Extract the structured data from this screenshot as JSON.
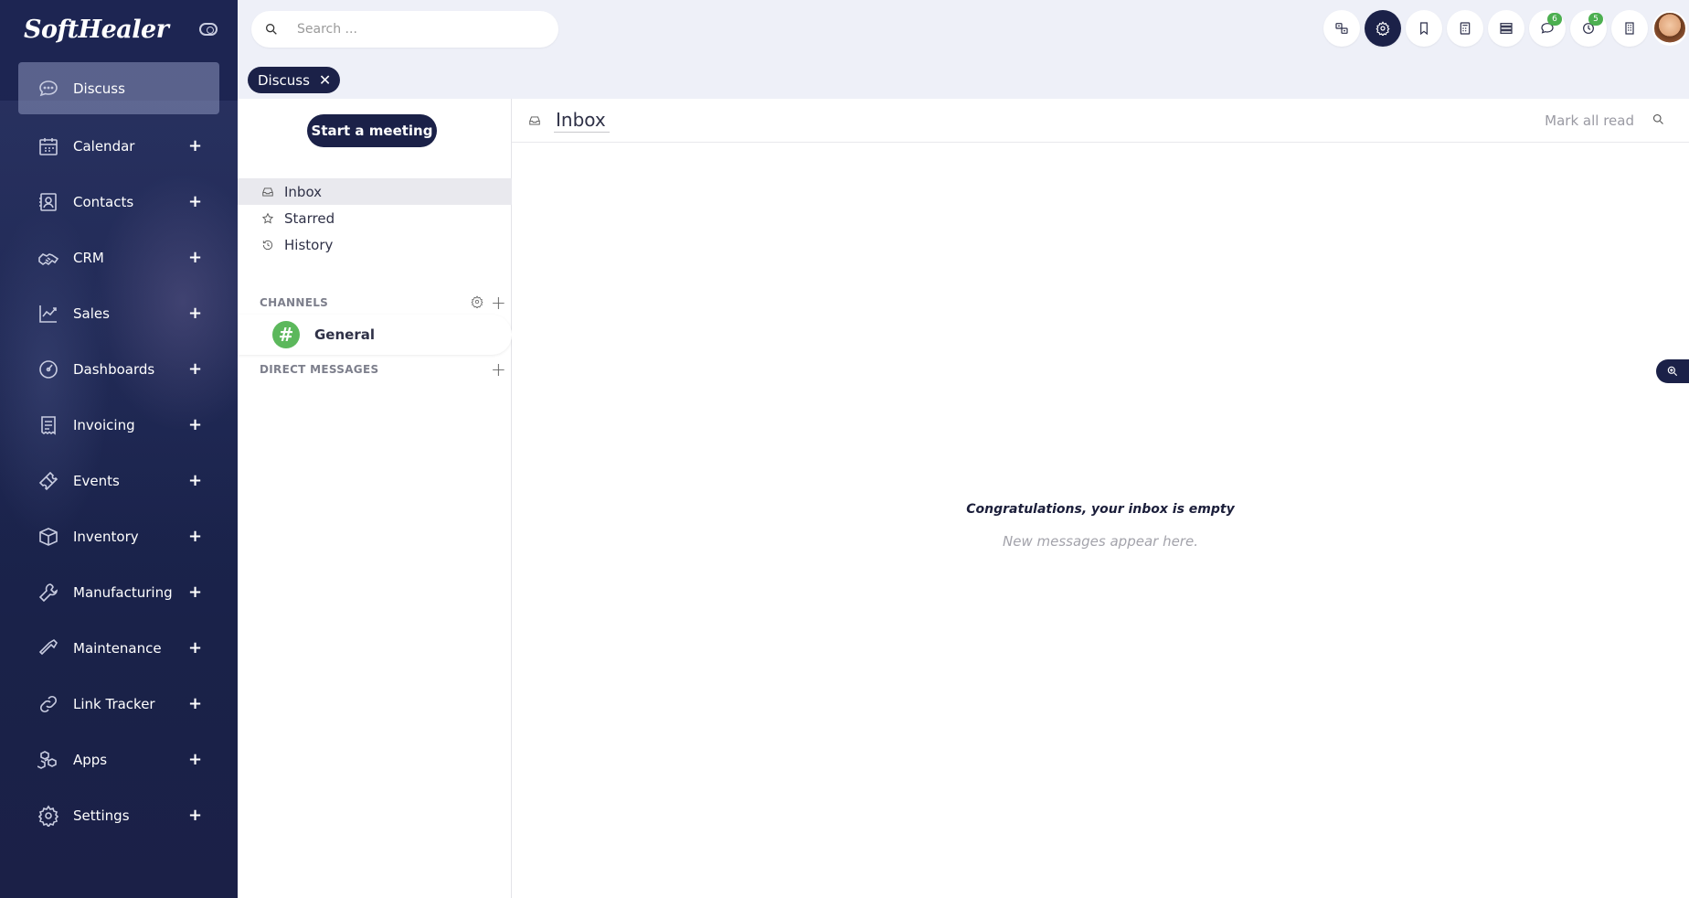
{
  "app": {
    "logo": "SoftHealer"
  },
  "sidebar": {
    "items": [
      {
        "label": "Discuss",
        "icon": "chat-icon",
        "active": true
      },
      {
        "label": "Calendar",
        "icon": "calendar-icon"
      },
      {
        "label": "Contacts",
        "icon": "contacts-icon"
      },
      {
        "label": "CRM",
        "icon": "handshake-icon"
      },
      {
        "label": "Sales",
        "icon": "chart-line-icon"
      },
      {
        "label": "Dashboards",
        "icon": "gauge-icon"
      },
      {
        "label": "Invoicing",
        "icon": "receipt-icon"
      },
      {
        "label": "Events",
        "icon": "ticket-icon"
      },
      {
        "label": "Inventory",
        "icon": "box-icon"
      },
      {
        "label": "Manufacturing",
        "icon": "wrench-icon"
      },
      {
        "label": "Maintenance",
        "icon": "hammer-icon"
      },
      {
        "label": "Link Tracker",
        "icon": "link-icon"
      },
      {
        "label": "Apps",
        "icon": "cubes-icon"
      },
      {
        "label": "Settings",
        "icon": "gear-icon"
      }
    ],
    "plus_glyph": "+"
  },
  "search": {
    "placeholder": "Search ..."
  },
  "topbar": {
    "chat_badge": "6",
    "activity_badge": "5"
  },
  "breadcrumb": {
    "label": "Discuss",
    "close": "✕"
  },
  "discuss": {
    "start_meeting": "Start a meeting",
    "mailboxes": [
      {
        "label": "Inbox",
        "active": true
      },
      {
        "label": "Starred"
      },
      {
        "label": "History"
      }
    ],
    "channels_header": "CHANNELS",
    "channels": [
      {
        "label": "General",
        "avatar": "#"
      }
    ],
    "direct_header": "DIRECT MESSAGES"
  },
  "inbox": {
    "title": "Inbox",
    "mark_all_read": "Mark all read",
    "empty_title": "Congratulations, your inbox is empty",
    "empty_sub": "New messages appear here."
  },
  "colors": {
    "primary": "#1b2148",
    "badge": "#4caf50",
    "channel": "#5cb85c"
  }
}
